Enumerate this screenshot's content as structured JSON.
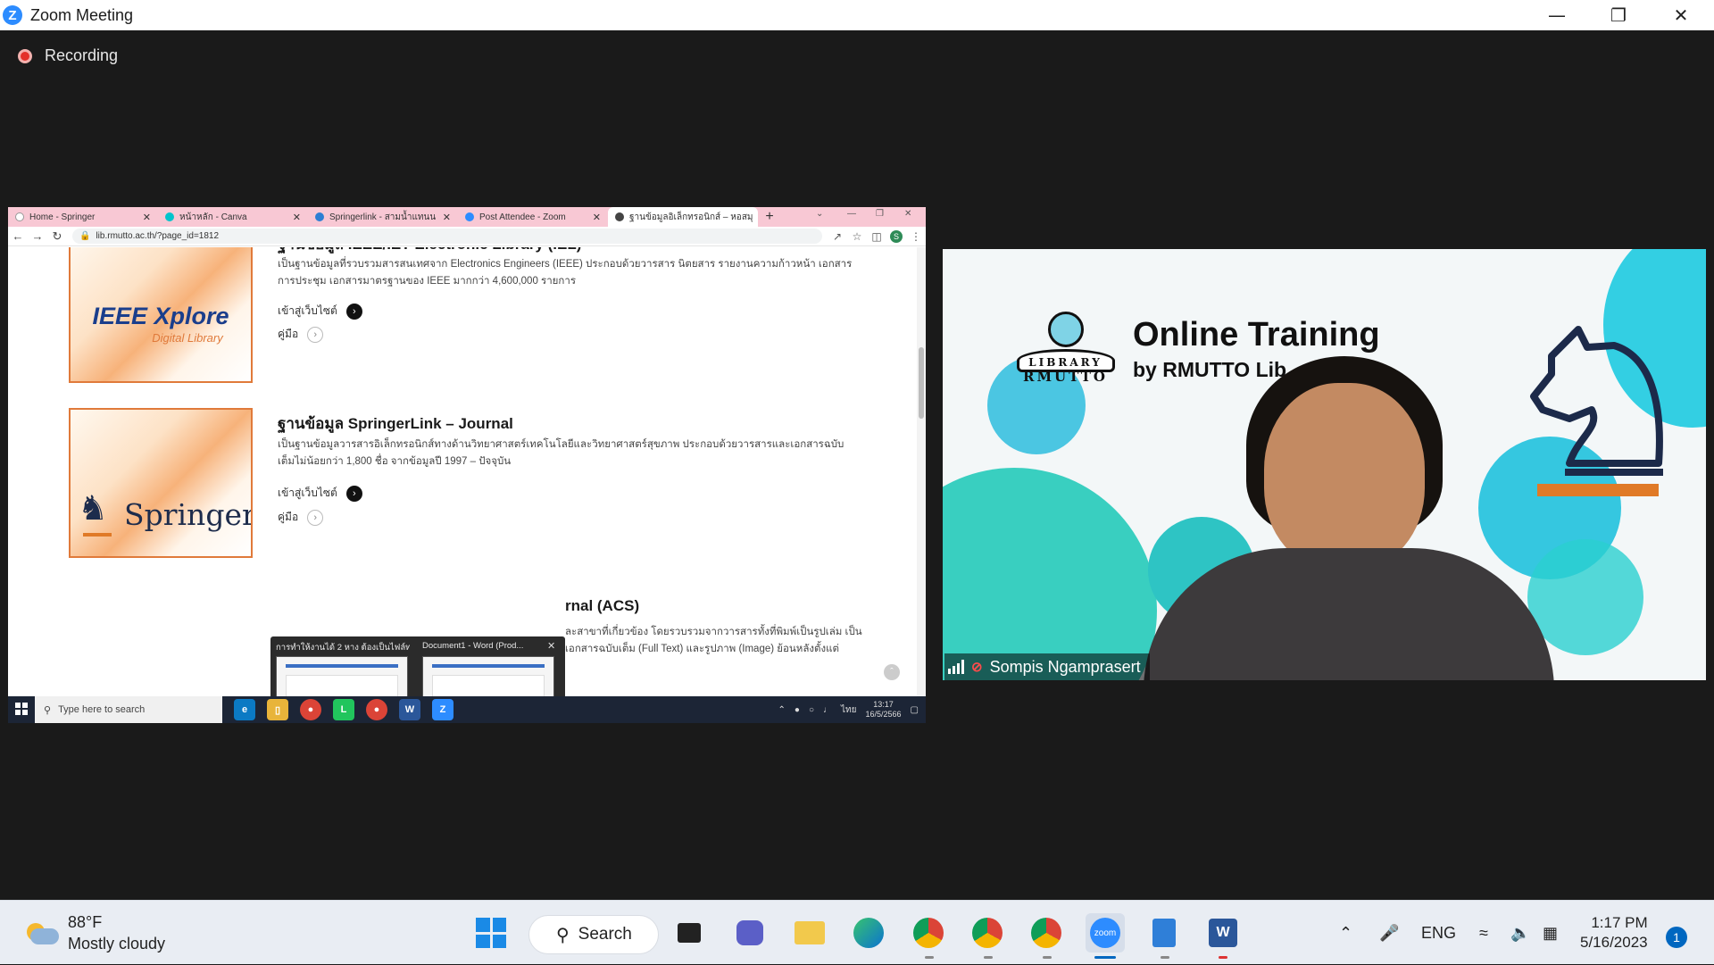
{
  "window": {
    "title": "Zoom Meeting"
  },
  "recording": {
    "label": "Recording"
  },
  "shared_screen": {
    "browser": {
      "tabs": [
        {
          "label": "Home - Springer",
          "color": "#ffffff"
        },
        {
          "label": "หน้าหลัก - Canva",
          "color": "#00c4cc"
        },
        {
          "label": "Springerlink - สามน้ำแทนน",
          "color": "#2d7fd3"
        },
        {
          "label": "Post Attendee - Zoom",
          "color": "#2d8cff"
        },
        {
          "label": "ฐานข้อมูลอิเล็กทรอนิกส์ – หอสมุ",
          "color": "#444444"
        }
      ],
      "url": "lib.rmutto.ac.th/?page_id=1812",
      "avatar_letter": "S"
    },
    "entries": [
      {
        "title": "ฐานข้อมูล IEEE/IET Electronic Library (IEL)",
        "logo_main": "IEEE Xplore",
        "logo_sub": "Digital Library",
        "desc": "เป็นฐานข้อมูลที่รวบรวมสารสนเทศจาก Electronics Engineers (IEEE) ประกอบด้วยวารสาร นิตยสาร รายงานความก้าวหน้า เอกสารการประชุม เอกสารมาตรฐานของ IEEE มากกว่า 4,600,000 รายการ",
        "visit": "เข้าสู่เว็บไซต์",
        "manual": "คู่มือ"
      },
      {
        "title": "ฐานข้อมูล SpringerLink – Journal",
        "logo_main": "Springer",
        "desc": "เป็นฐานข้อมูลวารสารอิเล็กทรอนิกส์ทางด้านวิทยาศาสตร์เทคโนโลยีและวิทยาศาสตร์สุขภาพ ประกอบด้วยวารสารและเอกสารฉบับเต็มไม่น้อยกว่า 1,800 ชื่อ จากข้อมูลปี 1997 – ปัจจุบัน",
        "visit": "เข้าสู่เว็บไซต์",
        "manual": "คู่มือ"
      },
      {
        "title": "rnal (ACS)",
        "desc": "ละสาขาที่เกี่ยวข้อง โดยรวบรวมจากวารสารทั้งที่พิมพ์เป็นรูปเล่ม เป็นเอกสารฉบับเต็ม (Full Text) และรูปภาพ (Image) ย้อนหลังตั้งแต่"
      }
    ],
    "previews": [
      {
        "label": "การทำให้งานได้ 2 หาง ต้องเป็นไฟล์ทอ..."
      },
      {
        "label": "Document1 - Word (Prod..."
      }
    ],
    "taskbar": {
      "search_placeholder": "Type here to search",
      "lang": "ไทย",
      "time": "13:17",
      "date": "16/5/2566"
    }
  },
  "video": {
    "title": "Online Training",
    "subtitle": "by RMUTTO Lib",
    "logo_line1": "LIBRARY",
    "logo_line2": "RMUTTO",
    "participant": "Sompis Ngamprasert",
    "accent_color": "#e07a27"
  },
  "taskbar": {
    "weather_temp": "88°F",
    "weather_desc": "Mostly cloudy",
    "search_label": "Search",
    "lang": "ENG",
    "time": "1:17 PM",
    "date": "5/16/2023",
    "notifications": "1"
  }
}
